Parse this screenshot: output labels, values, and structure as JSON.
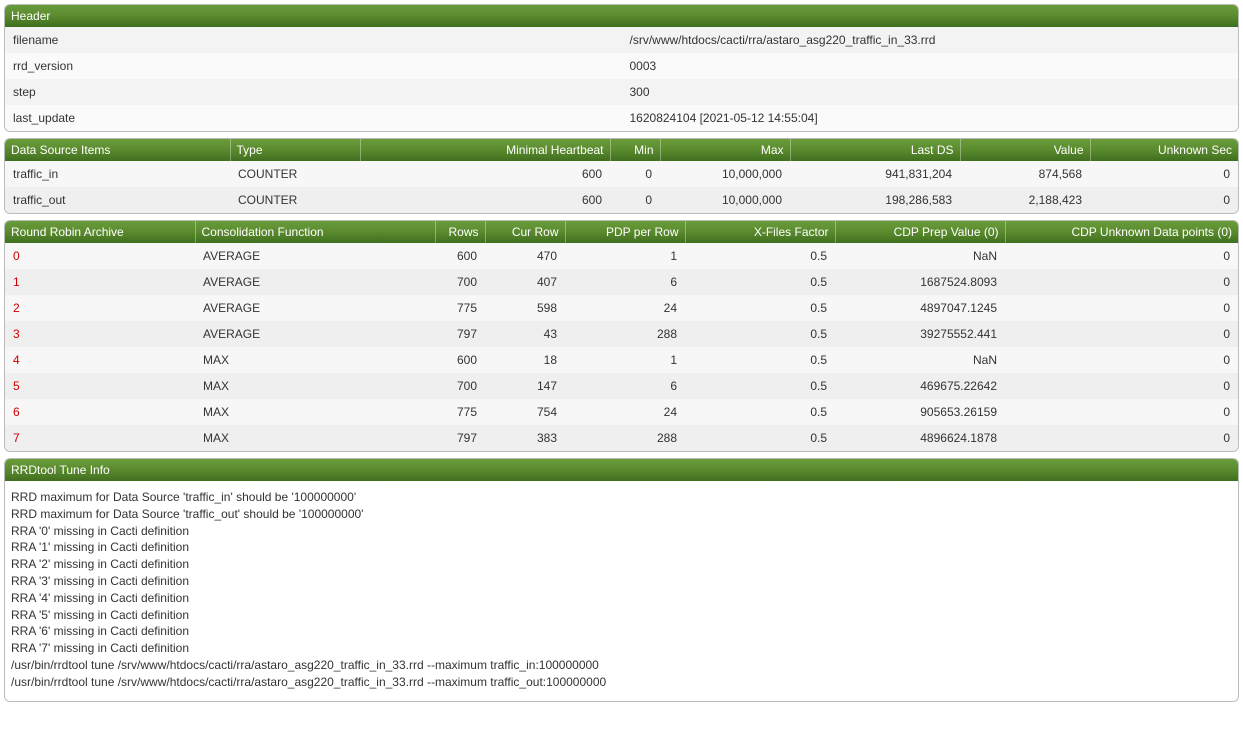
{
  "header": {
    "title": "Header",
    "rows": [
      {
        "key": "filename",
        "value": "/srv/www/htdocs/cacti/rra/astaro_asg220_traffic_in_33.rrd"
      },
      {
        "key": "rrd_version",
        "value": "0003"
      },
      {
        "key": "step",
        "value": "300"
      },
      {
        "key": "last_update",
        "value": "1620824104 [2021-05-12 14:55:04]"
      }
    ]
  },
  "ds": {
    "columns": {
      "c0": "Data Source Items",
      "c1": "Type",
      "c2": "Minimal Heartbeat",
      "c3": "Min",
      "c4": "Max",
      "c5": "Last DS",
      "c6": "Value",
      "c7": "Unknown Sec"
    },
    "rows": [
      {
        "name": "traffic_in",
        "type": "COUNTER",
        "heartbeat": "600",
        "min": "0",
        "max": "10,000,000",
        "last_ds": "941,831,204",
        "value": "874,568",
        "unknown_sec": "0"
      },
      {
        "name": "traffic_out",
        "type": "COUNTER",
        "heartbeat": "600",
        "min": "0",
        "max": "10,000,000",
        "last_ds": "198,286,583",
        "value": "2,188,423",
        "unknown_sec": "0"
      }
    ]
  },
  "rra": {
    "columns": {
      "c0": "Round Robin Archive",
      "c1": "Consolidation Function",
      "c2": "Rows",
      "c3": "Cur Row",
      "c4": "PDP per Row",
      "c5": "X-Files Factor",
      "c6": "CDP Prep Value (0)",
      "c7": "CDP Unknown Data points (0)"
    },
    "rows": [
      {
        "idx": "0",
        "cf": "AVERAGE",
        "rows": "600",
        "cur_row": "470",
        "pdp": "1",
        "xff": "0.5",
        "cdp_val": "NaN",
        "cdp_unk": "0"
      },
      {
        "idx": "1",
        "cf": "AVERAGE",
        "rows": "700",
        "cur_row": "407",
        "pdp": "6",
        "xff": "0.5",
        "cdp_val": "1687524.8093",
        "cdp_unk": "0"
      },
      {
        "idx": "2",
        "cf": "AVERAGE",
        "rows": "775",
        "cur_row": "598",
        "pdp": "24",
        "xff": "0.5",
        "cdp_val": "4897047.1245",
        "cdp_unk": "0"
      },
      {
        "idx": "3",
        "cf": "AVERAGE",
        "rows": "797",
        "cur_row": "43",
        "pdp": "288",
        "xff": "0.5",
        "cdp_val": "39275552.441",
        "cdp_unk": "0"
      },
      {
        "idx": "4",
        "cf": "MAX",
        "rows": "600",
        "cur_row": "18",
        "pdp": "1",
        "xff": "0.5",
        "cdp_val": "NaN",
        "cdp_unk": "0"
      },
      {
        "idx": "5",
        "cf": "MAX",
        "rows": "700",
        "cur_row": "147",
        "pdp": "6",
        "xff": "0.5",
        "cdp_val": "469675.22642",
        "cdp_unk": "0"
      },
      {
        "idx": "6",
        "cf": "MAX",
        "rows": "775",
        "cur_row": "754",
        "pdp": "24",
        "xff": "0.5",
        "cdp_val": "905653.26159",
        "cdp_unk": "0"
      },
      {
        "idx": "7",
        "cf": "MAX",
        "rows": "797",
        "cur_row": "383",
        "pdp": "288",
        "xff": "0.5",
        "cdp_val": "4896624.1878",
        "cdp_unk": "0"
      }
    ]
  },
  "tune": {
    "title": "RRDtool Tune Info",
    "lines": [
      "RRD maximum for Data Source 'traffic_in' should be '100000000'",
      "RRD maximum for Data Source 'traffic_out' should be '100000000'",
      "RRA '0' missing in Cacti definition",
      "RRA '1' missing in Cacti definition",
      "RRA '2' missing in Cacti definition",
      "RRA '3' missing in Cacti definition",
      "RRA '4' missing in Cacti definition",
      "RRA '5' missing in Cacti definition",
      "RRA '6' missing in Cacti definition",
      "RRA '7' missing in Cacti definition",
      "/usr/bin/rrdtool tune /srv/www/htdocs/cacti/rra/astaro_asg220_traffic_in_33.rrd --maximum traffic_in:100000000",
      "/usr/bin/rrdtool tune /srv/www/htdocs/cacti/rra/astaro_asg220_traffic_in_33.rrd --maximum traffic_out:100000000"
    ]
  }
}
